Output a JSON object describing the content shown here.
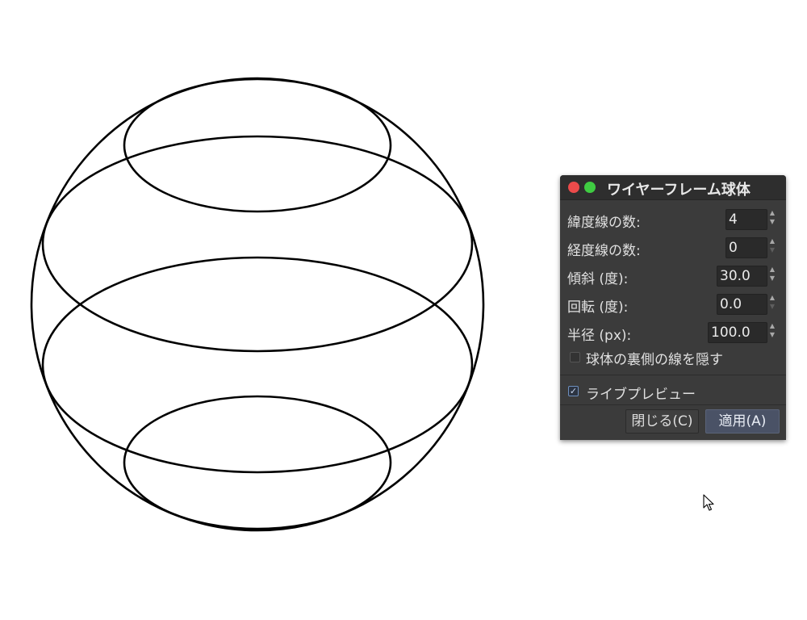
{
  "dialog": {
    "title": "ワイヤーフレーム球体",
    "fields": [
      {
        "label": "緯度線の数:",
        "value": "4"
      },
      {
        "label": "経度線の数:",
        "value": "0"
      },
      {
        "label": "傾斜 (度):",
        "value": "30.0"
      },
      {
        "label": "回転 (度):",
        "value": "0.0"
      },
      {
        "label": "半径 (px):",
        "value": "100.0"
      }
    ],
    "hide_back_lines": {
      "label": "球体の裏側の線を隠す",
      "checked": false
    },
    "live_preview": {
      "label": "ライブプレビュー",
      "checked": true
    },
    "buttons": {
      "close": "閉じる(C)",
      "apply": "適用(A)"
    }
  },
  "colors": {
    "dialog_bg": "#3b3b3b",
    "titlebar_bg": "#2e2e2e",
    "close_dot": "#ec4b4b",
    "maximize_dot": "#3fcc42",
    "apply_bg": "#4a5266",
    "stroke": "#000000"
  }
}
